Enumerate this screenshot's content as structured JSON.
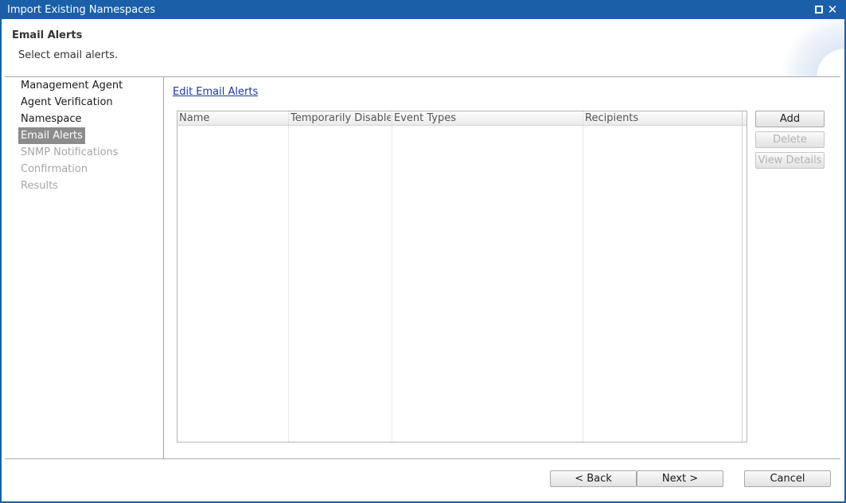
{
  "window": {
    "title": "Import Existing Namespaces",
    "restore_icon": "restore-icon",
    "close_icon": "close-icon",
    "close_glyph": "✕"
  },
  "header": {
    "title": "Email Alerts",
    "subtitle": "Select email alerts."
  },
  "nav": {
    "items": [
      {
        "label": "Management Agent",
        "state": "done"
      },
      {
        "label": "Agent Verification",
        "state": "done"
      },
      {
        "label": "Namespace",
        "state": "done"
      },
      {
        "label": "Email Alerts",
        "state": "active"
      },
      {
        "label": "SNMP Notifications",
        "state": "disabled"
      },
      {
        "label": "Confirmation",
        "state": "disabled"
      },
      {
        "label": "Results",
        "state": "disabled"
      }
    ]
  },
  "main": {
    "edit_link": "Edit Email Alerts",
    "table": {
      "columns": [
        "Name",
        "Temporarily Disabled",
        "Event Types",
        "Recipients"
      ],
      "rows": []
    },
    "buttons": {
      "add": "Add",
      "delete": "Delete",
      "view_details": "View Details"
    }
  },
  "footer": {
    "back": "< Back",
    "next": "Next >",
    "cancel": "Cancel"
  },
  "colors": {
    "titlebar": "#1a5fa8",
    "active_nav": "#8c8c8c",
    "link": "#1f3a93"
  }
}
